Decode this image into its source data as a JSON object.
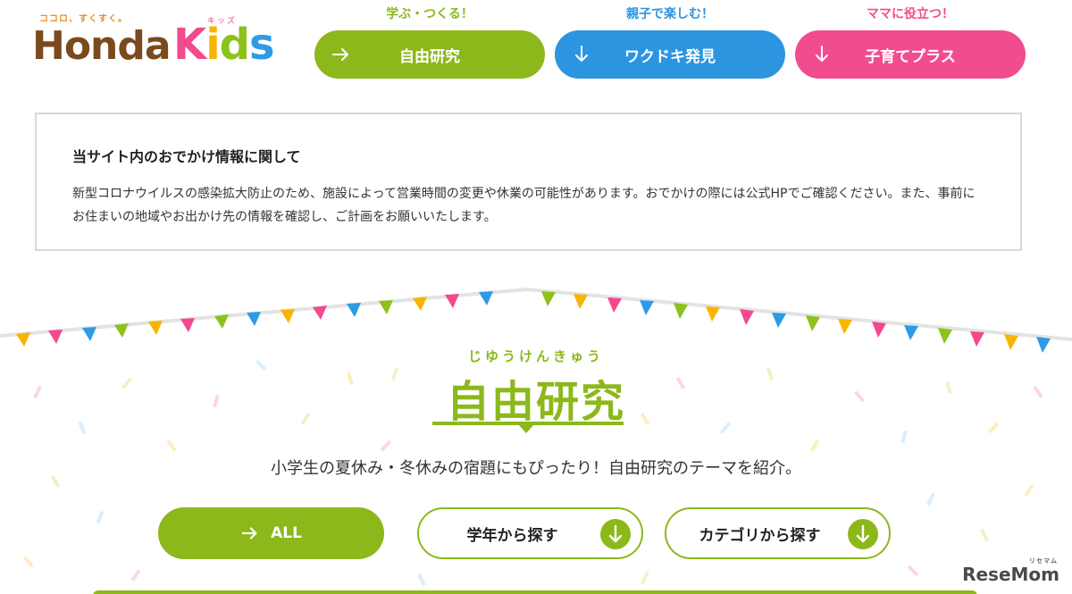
{
  "logo": {
    "tagline": "ココロ、すくすく。",
    "honda": "Honda",
    "kids_letters": [
      "K",
      "i",
      "d",
      "s"
    ],
    "ruby": "キッズ"
  },
  "nav": [
    {
      "caption": "学ぶ・つくる！",
      "label": "自由研究",
      "icon": "arrow-right-icon",
      "color": "#8cb81b"
    },
    {
      "caption": "親子で楽しむ！",
      "label": "ワクドキ発見",
      "icon": "arrow-down-icon",
      "color": "#2d95e0"
    },
    {
      "caption": "ママに役立つ！",
      "label": "子育てプラス",
      "icon": "arrow-down-icon",
      "color": "#f14d8e"
    }
  ],
  "notice": {
    "title": "当サイト内のおでかけ情報に関して",
    "body": "新型コロナウイルスの感染拡大防止のため、施設によって営業時間の変更や休業の可能性があります。おでかけの際には公式HPでご確認ください。また、事前にお住まいの地域やお出かけ先の情報を確認し、ご計画をお願いいたします。"
  },
  "feature": {
    "ruby": "じゆうけんきゅう",
    "title": "自由研究",
    "lead": "小学生の夏休み・冬休みの宿題にもぴったり！自由研究のテーマを紹介。",
    "buttons": {
      "all": "ALL",
      "grade": "学年から探す",
      "category": "カテゴリから探す"
    },
    "accent": "#8cb81b"
  },
  "watermark": {
    "text": "ReseMom",
    "sub": "リセマム"
  }
}
